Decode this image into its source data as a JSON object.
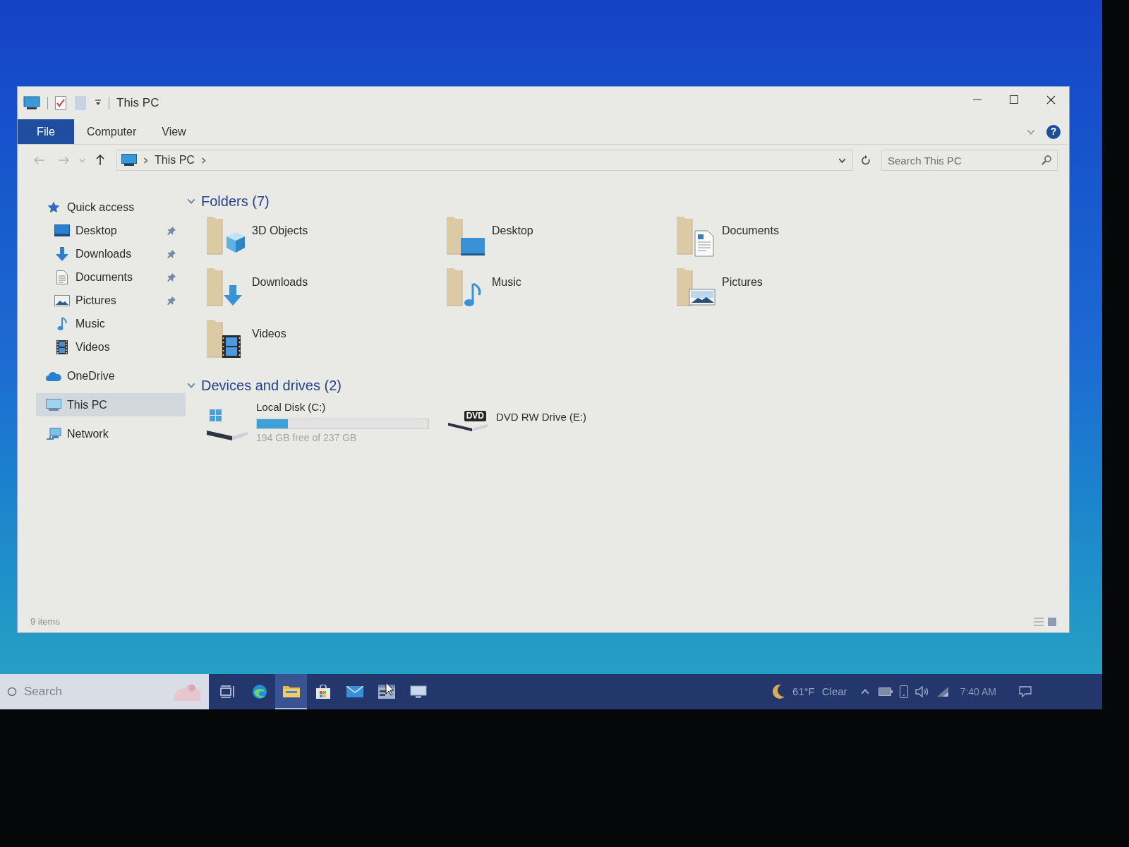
{
  "window": {
    "title": "This PC"
  },
  "ribbon": {
    "tabs": [
      {
        "label": "File",
        "kind": "file",
        "selected": false
      },
      {
        "label": "Computer",
        "kind": "tab",
        "selected": false
      },
      {
        "label": "View",
        "kind": "tab",
        "selected": false
      }
    ],
    "help": "?"
  },
  "navigation": {
    "back": {
      "disabled": true
    },
    "forward": {
      "disabled": true
    },
    "recent": {
      "disabled": true
    },
    "up": {
      "disabled": false
    },
    "path": [
      "This PC"
    ]
  },
  "search": {
    "placeholder": "Search This PC"
  },
  "sidebar": {
    "items": [
      {
        "label": "Quick access",
        "kind": "star",
        "selected": false,
        "children": [
          {
            "label": "Desktop",
            "kind": "desktop",
            "pinned": true,
            "selected": false
          },
          {
            "label": "Downloads",
            "kind": "downloads",
            "pinned": true,
            "selected": false
          },
          {
            "label": "Documents",
            "kind": "documents",
            "pinned": true,
            "selected": false
          },
          {
            "label": "Pictures",
            "kind": "pictures",
            "pinned": true,
            "selected": false
          },
          {
            "label": "Music",
            "kind": "music",
            "pinned": false,
            "selected": false
          },
          {
            "label": "Videos",
            "kind": "videos",
            "pinned": false,
            "selected": false
          }
        ]
      },
      {
        "label": "OneDrive",
        "kind": "cloud",
        "selected": false
      },
      {
        "label": "This PC",
        "kind": "pc",
        "selected": true
      },
      {
        "label": "Network",
        "kind": "network",
        "selected": false
      }
    ]
  },
  "groups": [
    {
      "title": "Folders (7)",
      "kind": "folders",
      "expanded": true,
      "items": [
        {
          "name": "3D Objects",
          "kind": "objects"
        },
        {
          "name": "Desktop",
          "kind": "desktop"
        },
        {
          "name": "Documents",
          "kind": "documents"
        },
        {
          "name": "Downloads",
          "kind": "downloads"
        },
        {
          "name": "Music",
          "kind": "music"
        },
        {
          "name": "Pictures",
          "kind": "pictures"
        },
        {
          "name": "Videos",
          "kind": "videos"
        }
      ]
    },
    {
      "title": "Devices and drives (2)",
      "kind": "drives",
      "expanded": true,
      "items": [
        {
          "name": "Local Disk (C:)",
          "kind": "disk",
          "level": 0.18,
          "detail": "194 GB free of 237 GB"
        },
        {
          "name": "DVD RW Drive (E:)",
          "kind": "dvd",
          "badge": "DVD"
        }
      ]
    }
  ],
  "status_bar": {
    "count": "9 items"
  },
  "taskbar": {
    "search": {
      "placeholder": "Search"
    },
    "apps": [
      {
        "kind": "taskview",
        "selected": false
      },
      {
        "kind": "browser",
        "selected": false
      },
      {
        "kind": "explorer",
        "selected": true
      },
      {
        "kind": "store",
        "selected": false
      },
      {
        "kind": "mail",
        "selected": false
      },
      {
        "kind": "window",
        "selected": false
      },
      {
        "kind": "monitor",
        "selected": false
      }
    ],
    "weather": {
      "temperature": "61°F",
      "condition": "Clear"
    },
    "clock": "7:40 AM"
  }
}
